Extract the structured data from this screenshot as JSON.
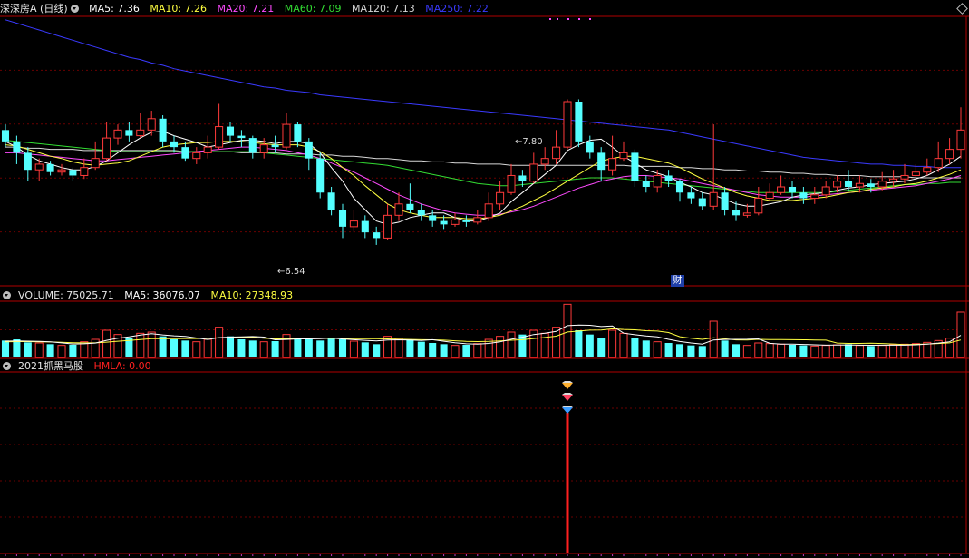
{
  "colors": {
    "bg": "#000000",
    "grid": "#6a0000",
    "panel_border": "#b00000",
    "up": "#ff3a3a",
    "down": "#54ffff",
    "ma5": "#ffffff",
    "ma10": "#ffff40",
    "ma20": "#ff4bff",
    "ma60": "#33dd33",
    "ma120": "#d8d8d8",
    "ma250": "#3a3aff",
    "vol_ma5": "#ffffff",
    "vol_ma10": "#ffff40",
    "hmla": "#ff2020"
  },
  "header": {
    "stock_label": "深深房A (日线)",
    "indicators": [
      {
        "key": "ma5",
        "text": "MA5: 7.36"
      },
      {
        "key": "ma10",
        "text": "MA10: 7.26"
      },
      {
        "key": "ma20",
        "text": "MA20: 7.21"
      },
      {
        "key": "ma60",
        "text": "MA60: 7.09"
      },
      {
        "key": "ma120",
        "text": "MA120: 7.13"
      },
      {
        "key": "ma250",
        "text": "MA250: 7.22"
      }
    ]
  },
  "volume_header": {
    "label": "VOLUME: 75025.71",
    "ma5": "MA5: 36076.07",
    "ma10": "MA10: 27348.93"
  },
  "indicator_header": {
    "label": "2021抓黑马股",
    "hmla": "HMLA: 0.00"
  },
  "annotations": {
    "high_label": "7.80",
    "low_label": "6.54",
    "fin_badge": "财"
  },
  "chart_data": {
    "type": "candlestick",
    "price_range": [
      6.3,
      8.55
    ],
    "high": 7.8,
    "low": 6.54,
    "candles": [
      [
        7.55,
        7.45,
        7.6,
        7.4
      ],
      [
        7.45,
        7.35,
        7.5,
        7.25
      ],
      [
        7.35,
        7.2,
        7.4,
        7.1
      ],
      [
        7.2,
        7.25,
        7.3,
        7.1
      ],
      [
        7.25,
        7.18,
        7.28,
        7.15
      ],
      [
        7.18,
        7.2,
        7.25,
        7.15
      ],
      [
        7.2,
        7.15,
        7.22,
        7.1
      ],
      [
        7.15,
        7.22,
        7.3,
        7.12
      ],
      [
        7.22,
        7.3,
        7.45,
        7.2
      ],
      [
        7.3,
        7.48,
        7.62,
        7.28
      ],
      [
        7.48,
        7.55,
        7.6,
        7.42
      ],
      [
        7.55,
        7.5,
        7.62,
        7.45
      ],
      [
        7.5,
        7.55,
        7.7,
        7.48
      ],
      [
        7.55,
        7.65,
        7.72,
        7.5
      ],
      [
        7.65,
        7.45,
        7.68,
        7.4
      ],
      [
        7.45,
        7.4,
        7.5,
        7.35
      ],
      [
        7.4,
        7.3,
        7.45,
        7.28
      ],
      [
        7.3,
        7.35,
        7.4,
        7.25
      ],
      [
        7.35,
        7.4,
        7.5,
        7.3
      ],
      [
        7.4,
        7.58,
        7.78,
        7.38
      ],
      [
        7.58,
        7.5,
        7.62,
        7.45
      ],
      [
        7.5,
        7.48,
        7.55,
        7.4
      ],
      [
        7.48,
        7.35,
        7.5,
        7.3
      ],
      [
        7.35,
        7.42,
        7.48,
        7.3
      ],
      [
        7.42,
        7.4,
        7.5,
        7.35
      ],
      [
        7.4,
        7.6,
        7.7,
        7.38
      ],
      [
        7.6,
        7.45,
        7.62,
        7.4
      ],
      [
        7.45,
        7.3,
        7.48,
        7.2
      ],
      [
        7.3,
        7.0,
        7.35,
        6.95
      ],
      [
        7.0,
        6.85,
        7.05,
        6.8
      ],
      [
        6.85,
        6.7,
        6.9,
        6.6
      ],
      [
        6.7,
        6.75,
        6.85,
        6.65
      ],
      [
        6.75,
        6.65,
        6.8,
        6.6
      ],
      [
        6.65,
        6.6,
        6.7,
        6.54
      ],
      [
        6.6,
        6.8,
        6.9,
        6.58
      ],
      [
        6.8,
        6.9,
        7.0,
        6.75
      ],
      [
        6.9,
        6.85,
        7.08,
        6.82
      ],
      [
        6.85,
        6.8,
        6.9,
        6.75
      ],
      [
        6.8,
        6.75,
        6.85,
        6.7
      ],
      [
        6.75,
        6.72,
        6.8,
        6.68
      ],
      [
        6.72,
        6.76,
        6.82,
        6.7
      ],
      [
        6.76,
        6.74,
        6.8,
        6.7
      ],
      [
        6.74,
        6.78,
        6.85,
        6.72
      ],
      [
        6.78,
        6.9,
        7.0,
        6.75
      ],
      [
        6.9,
        7.0,
        7.1,
        6.85
      ],
      [
        7.0,
        7.15,
        7.25,
        6.98
      ],
      [
        7.15,
        7.1,
        7.2,
        7.05
      ],
      [
        7.1,
        7.25,
        7.35,
        7.08
      ],
      [
        7.25,
        7.3,
        7.4,
        7.2
      ],
      [
        7.3,
        7.4,
        7.55,
        7.25
      ],
      [
        7.4,
        7.8,
        7.82,
        7.38
      ],
      [
        7.8,
        7.45,
        7.82,
        7.4
      ],
      [
        7.45,
        7.35,
        7.5,
        7.3
      ],
      [
        7.35,
        7.2,
        7.4,
        7.1
      ],
      [
        7.2,
        7.3,
        7.5,
        7.15
      ],
      [
        7.3,
        7.35,
        7.45,
        7.28
      ],
      [
        7.35,
        7.1,
        7.38,
        7.05
      ],
      [
        7.1,
        7.05,
        7.15,
        7.0
      ],
      [
        7.05,
        7.15,
        7.2,
        7.0
      ],
      [
        7.15,
        7.1,
        7.2,
        7.05
      ],
      [
        7.1,
        7.0,
        7.12,
        6.92
      ],
      [
        7.0,
        6.95,
        7.05,
        6.9
      ],
      [
        6.95,
        6.88,
        7.0,
        6.85
      ],
      [
        6.88,
        7.0,
        7.6,
        6.85
      ],
      [
        7.0,
        6.85,
        7.05,
        6.8
      ],
      [
        6.85,
        6.8,
        6.92,
        6.75
      ],
      [
        6.8,
        6.82,
        6.9,
        6.78
      ],
      [
        6.82,
        6.95,
        7.05,
        6.8
      ],
      [
        6.95,
        7.0,
        7.08,
        6.92
      ],
      [
        7.0,
        7.05,
        7.15,
        6.98
      ],
      [
        7.05,
        7.0,
        7.1,
        6.95
      ],
      [
        7.0,
        6.95,
        7.05,
        6.9
      ],
      [
        6.95,
        6.98,
        7.05,
        6.9
      ],
      [
        6.98,
        7.05,
        7.1,
        6.95
      ],
      [
        7.05,
        7.1,
        7.15,
        7.0
      ],
      [
        7.1,
        7.05,
        7.2,
        7.02
      ],
      [
        7.05,
        7.08,
        7.15,
        7.0
      ],
      [
        7.08,
        7.05,
        7.12,
        7.0
      ],
      [
        7.05,
        7.1,
        7.18,
        7.02
      ],
      [
        7.1,
        7.12,
        7.2,
        7.05
      ],
      [
        7.12,
        7.15,
        7.25,
        7.08
      ],
      [
        7.15,
        7.18,
        7.25,
        7.12
      ],
      [
        7.18,
        7.22,
        7.3,
        7.15
      ],
      [
        7.22,
        7.3,
        7.45,
        7.18
      ],
      [
        7.3,
        7.38,
        7.48,
        7.25
      ],
      [
        7.38,
        7.55,
        7.75,
        7.3
      ]
    ],
    "ma5": [
      7.45,
      7.4,
      7.33,
      7.28,
      7.25,
      7.22,
      7.2,
      7.2,
      7.23,
      7.28,
      7.35,
      7.42,
      7.48,
      7.53,
      7.54,
      7.5,
      7.47,
      7.44,
      7.4,
      7.42,
      7.44,
      7.46,
      7.46,
      7.45,
      7.43,
      7.45,
      7.45,
      7.43,
      7.35,
      7.22,
      7.1,
      6.95,
      6.85,
      6.75,
      6.72,
      6.74,
      6.78,
      6.8,
      6.82,
      6.82,
      6.78,
      6.75,
      6.75,
      6.78,
      6.82,
      6.92,
      7.0,
      7.08,
      7.16,
      7.24,
      7.37,
      7.42,
      7.46,
      7.47,
      7.4,
      7.32,
      7.26,
      7.2,
      7.17,
      7.14,
      7.09,
      7.05,
      7.0,
      6.98,
      6.94,
      6.9,
      6.88,
      6.88,
      6.9,
      6.92,
      6.96,
      6.98,
      6.99,
      7.0,
      7.02,
      7.04,
      7.05,
      7.07,
      7.08,
      7.09,
      7.1,
      7.12,
      7.15,
      7.2,
      7.25,
      7.32
    ],
    "ma10": [
      7.42,
      7.41,
      7.38,
      7.35,
      7.32,
      7.3,
      7.27,
      7.25,
      7.24,
      7.25,
      7.26,
      7.28,
      7.32,
      7.36,
      7.4,
      7.42,
      7.43,
      7.44,
      7.44,
      7.45,
      7.45,
      7.45,
      7.44,
      7.43,
      7.42,
      7.42,
      7.42,
      7.4,
      7.36,
      7.3,
      7.22,
      7.15,
      7.06,
      6.98,
      6.9,
      6.85,
      6.82,
      6.8,
      6.78,
      6.78,
      6.78,
      6.77,
      6.77,
      6.78,
      6.8,
      6.84,
      6.88,
      6.93,
      6.98,
      7.04,
      7.1,
      7.16,
      7.22,
      7.28,
      7.3,
      7.32,
      7.32,
      7.3,
      7.28,
      7.26,
      7.22,
      7.17,
      7.12,
      7.08,
      7.04,
      7.0,
      6.97,
      6.95,
      6.93,
      6.93,
      6.93,
      6.94,
      6.95,
      6.96,
      6.98,
      7.0,
      7.01,
      7.03,
      7.04,
      7.05,
      7.07,
      7.08,
      7.1,
      7.13,
      7.16,
      7.2
    ],
    "ma20": [
      7.35,
      7.35,
      7.34,
      7.33,
      7.32,
      7.31,
      7.3,
      7.29,
      7.28,
      7.28,
      7.29,
      7.3,
      7.31,
      7.32,
      7.33,
      7.34,
      7.35,
      7.36,
      7.37,
      7.38,
      7.39,
      7.4,
      7.4,
      7.39,
      7.38,
      7.37,
      7.35,
      7.33,
      7.3,
      7.26,
      7.22,
      7.18,
      7.13,
      7.08,
      7.03,
      6.98,
      6.94,
      6.9,
      6.87,
      6.84,
      6.82,
      6.81,
      6.8,
      6.8,
      6.81,
      6.83,
      6.85,
      6.88,
      6.92,
      6.96,
      7.0,
      7.04,
      7.07,
      7.1,
      7.12,
      7.14,
      7.15,
      7.15,
      7.14,
      7.13,
      7.12,
      7.1,
      7.08,
      7.06,
      7.04,
      7.02,
      7.0,
      6.98,
      6.97,
      6.96,
      6.96,
      6.96,
      6.97,
      6.98,
      6.99,
      7.0,
      7.01,
      7.02,
      7.03,
      7.04,
      7.05,
      7.06,
      7.08,
      7.1,
      7.12,
      7.15
    ],
    "ma60": [
      7.46,
      7.45,
      7.44,
      7.43,
      7.42,
      7.41,
      7.4,
      7.39,
      7.38,
      7.37,
      7.36,
      7.36,
      7.36,
      7.36,
      7.36,
      7.36,
      7.36,
      7.36,
      7.36,
      7.36,
      7.36,
      7.36,
      7.36,
      7.35,
      7.34,
      7.33,
      7.32,
      7.31,
      7.3,
      7.29,
      7.28,
      7.27,
      7.26,
      7.25,
      7.24,
      7.22,
      7.2,
      7.18,
      7.16,
      7.14,
      7.12,
      7.1,
      7.08,
      7.07,
      7.06,
      7.06,
      7.07,
      7.08,
      7.09,
      7.1,
      7.11,
      7.12,
      7.13,
      7.13,
      7.13,
      7.12,
      7.11,
      7.1,
      7.09,
      7.08,
      7.07,
      7.06,
      7.05,
      7.04,
      7.03,
      7.02,
      7.01,
      7.0,
      7.0,
      7.0,
      7.0,
      7.0,
      7.0,
      7.0,
      7.01,
      7.02,
      7.03,
      7.04,
      7.05,
      7.06,
      7.07,
      7.07,
      7.08,
      7.08,
      7.09,
      7.09
    ],
    "ma120": [
      7.4,
      7.4,
      7.39,
      7.39,
      7.38,
      7.38,
      7.38,
      7.37,
      7.37,
      7.37,
      7.37,
      7.37,
      7.37,
      7.37,
      7.37,
      7.37,
      7.36,
      7.36,
      7.36,
      7.36,
      7.36,
      7.35,
      7.35,
      7.35,
      7.35,
      7.34,
      7.34,
      7.34,
      7.33,
      7.33,
      7.32,
      7.32,
      7.31,
      7.3,
      7.3,
      7.29,
      7.28,
      7.28,
      7.27,
      7.27,
      7.26,
      7.26,
      7.25,
      7.25,
      7.25,
      7.24,
      7.24,
      7.24,
      7.24,
      7.24,
      7.24,
      7.24,
      7.24,
      7.24,
      7.24,
      7.24,
      7.23,
      7.23,
      7.23,
      7.23,
      7.22,
      7.22,
      7.21,
      7.21,
      7.2,
      7.2,
      7.19,
      7.19,
      7.18,
      7.18,
      7.17,
      7.17,
      7.16,
      7.16,
      7.15,
      7.15,
      7.15,
      7.14,
      7.14,
      7.14,
      7.14,
      7.13,
      7.13,
      7.13,
      7.13,
      7.13
    ],
    "ma250": [
      8.52,
      8.49,
      8.46,
      8.43,
      8.4,
      8.37,
      8.34,
      8.31,
      8.28,
      8.25,
      8.22,
      8.19,
      8.17,
      8.14,
      8.12,
      8.09,
      8.07,
      8.05,
      8.03,
      8.01,
      7.99,
      7.97,
      7.95,
      7.93,
      7.92,
      7.9,
      7.89,
      7.88,
      7.86,
      7.85,
      7.84,
      7.83,
      7.82,
      7.81,
      7.8,
      7.79,
      7.78,
      7.77,
      7.76,
      7.75,
      7.74,
      7.73,
      7.72,
      7.71,
      7.7,
      7.69,
      7.68,
      7.67,
      7.66,
      7.65,
      7.64,
      7.63,
      7.62,
      7.61,
      7.6,
      7.59,
      7.58,
      7.57,
      7.56,
      7.55,
      7.53,
      7.51,
      7.49,
      7.47,
      7.45,
      7.43,
      7.41,
      7.39,
      7.37,
      7.35,
      7.33,
      7.31,
      7.3,
      7.29,
      7.28,
      7.27,
      7.26,
      7.25,
      7.25,
      7.24,
      7.24,
      7.23,
      7.23,
      7.22,
      7.22,
      7.22
    ],
    "volume_range": [
      0,
      90000
    ],
    "volume": [
      28000,
      30000,
      25000,
      24000,
      22000,
      20000,
      21000,
      26000,
      30000,
      45000,
      38000,
      32000,
      40000,
      42000,
      35000,
      30000,
      28000,
      26000,
      30000,
      50000,
      35000,
      30000,
      28000,
      26000,
      27000,
      38000,
      33000,
      30000,
      28000,
      32000,
      30000,
      27000,
      25000,
      22000,
      35000,
      32000,
      30000,
      26000,
      24000,
      22000,
      20000,
      21000,
      23000,
      30000,
      35000,
      42000,
      38000,
      45000,
      40000,
      50000,
      88000,
      45000,
      38000,
      33000,
      45000,
      40000,
      32000,
      28000,
      26000,
      24000,
      22000,
      20000,
      19000,
      60000,
      28000,
      22000,
      20000,
      24000,
      23000,
      22000,
      21000,
      20000,
      19000,
      20000,
      21000,
      22000,
      20000,
      19000,
      20000,
      21000,
      22000,
      23000,
      25000,
      28000,
      32000,
      75025
    ],
    "vol_ma5": [
      27000,
      27500,
      27000,
      26500,
      25800,
      24200,
      22400,
      22600,
      23800,
      28400,
      32000,
      34200,
      37000,
      39400,
      37400,
      35800,
      35000,
      32200,
      29800,
      32800,
      33800,
      34200,
      34600,
      33800,
      29200,
      29800,
      30800,
      30800,
      31200,
      32200,
      30600,
      29400,
      28400,
      27400,
      28800,
      29200,
      28800,
      28000,
      29400,
      26800,
      24400,
      22600,
      22000,
      23200,
      25800,
      30200,
      33600,
      38000,
      40000,
      43000,
      52600,
      53600,
      53200,
      51200,
      52200,
      40200,
      37600,
      35600,
      34200,
      30000,
      26400,
      24000,
      22200,
      29000,
      29800,
      30000,
      30200,
      30800,
      23400,
      22200,
      22000,
      21600,
      21000,
      20400,
      20600,
      20800,
      20400,
      20200,
      20400,
      20400,
      20400,
      21000,
      22200,
      23800,
      26000,
      36600
    ],
    "vol_ma10": [
      26000,
      26200,
      26200,
      26000,
      25600,
      25000,
      24400,
      24100,
      24200,
      25300,
      26900,
      28000,
      29500,
      31000,
      31300,
      31200,
      31300,
      31300,
      32000,
      32500,
      32800,
      33200,
      33300,
      31900,
      30800,
      30800,
      31600,
      31900,
      31600,
      31800,
      31500,
      31200,
      31300,
      31000,
      30800,
      30200,
      29900,
      29400,
      29300,
      28600,
      27600,
      26700,
      26200,
      26600,
      27500,
      28500,
      29400,
      31300,
      33200,
      35300,
      42200,
      43600,
      45100,
      45400,
      47400,
      46400,
      45700,
      44300,
      43600,
      41200,
      34300,
      32000,
      30000,
      32600,
      30900,
      29100,
      29000,
      30000,
      29700,
      29500,
      29400,
      29200,
      29000,
      28600,
      23800,
      23200,
      23200,
      23500,
      23100,
      22300,
      21500,
      21700,
      22300,
      23100,
      24200,
      29000
    ],
    "hmla_signal_index": 50
  }
}
